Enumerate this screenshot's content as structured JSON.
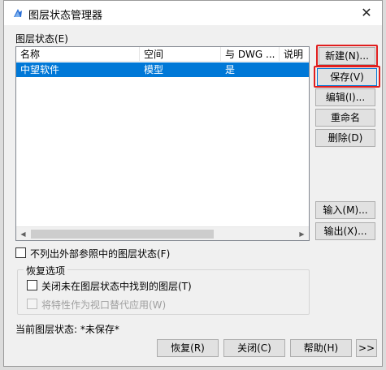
{
  "window": {
    "title": "图层状态管理器",
    "close_glyph": "✕"
  },
  "layer_states_label": "图层状态(E)",
  "list": {
    "columns": [
      "名称",
      "空间",
      "与 DWG ...",
      "说明"
    ],
    "rows": [
      {
        "name": "中望软件",
        "space": "模型",
        "dwg": "是",
        "desc": ""
      }
    ],
    "scroll_left": "◀",
    "scroll_right": "▶"
  },
  "side_buttons": {
    "new": "新建(N)...",
    "save": "保存(V)",
    "edit": "编辑(I)...",
    "rename": "重命名",
    "delete": "删除(D)",
    "import": "输入(M)...",
    "export": "输出(X)..."
  },
  "no_xref_checkbox": {
    "label": "不列出外部参照中的图层状态(F)",
    "checked": false
  },
  "restore_options": {
    "title": "恢复选项",
    "turn_off_layers": {
      "label": "关闭未在图层状态中找到的图层(T)",
      "checked": false
    },
    "viewport_override": {
      "label": "将特性作为视口替代应用(W)",
      "checked": false,
      "enabled": false
    }
  },
  "current_state": {
    "label": "当前图层状态: *未保存*"
  },
  "bottom_buttons": {
    "restore": "恢复(R)",
    "close": "关闭(C)",
    "help": "帮助(H)",
    "more": ">>"
  },
  "colors": {
    "selection": "#0078d7",
    "highlight": "#e01e1e",
    "accent": "#0078d7"
  }
}
